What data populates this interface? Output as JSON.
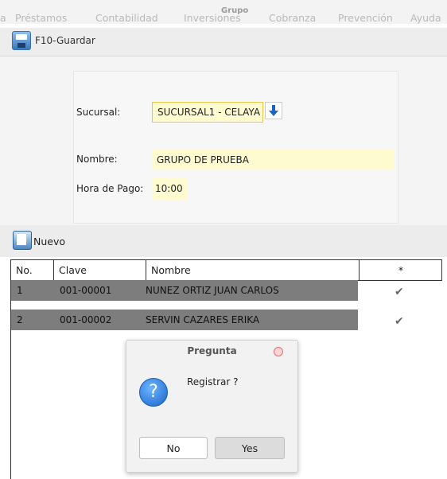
{
  "menu": {
    "title": "Grupo",
    "items": [
      "a",
      "Préstamos",
      "Contabilidad",
      "Inversiones",
      "Cobranza",
      "Prevención",
      "Ayuda"
    ]
  },
  "toolbar": {
    "save_label": "F10-Guardar"
  },
  "form": {
    "sucursal_label": "Sucursal:",
    "sucursal_value": "SUCURSAL1 - CELAYA",
    "nombre_label": "Nombre:",
    "nombre_value": "GRUPO DE PRUEBA",
    "hora_label": "Hora de Pago:",
    "hora_value": "10:00"
  },
  "nuevo": {
    "label": "Nuevo"
  },
  "table": {
    "headers": [
      "No.",
      "Clave",
      "Nombre",
      "*"
    ],
    "rows": [
      {
        "no": "1",
        "clave": "001-00001",
        "nombre": "NUNEZ ORTIZ JUAN CARLOS"
      },
      {
        "no": "2",
        "clave": "001-00002",
        "nombre": "SERVIN CAZARES ERIKA"
      }
    ]
  },
  "dialog": {
    "title": "Pregunta",
    "message": "Registrar ?",
    "no_label": "No",
    "yes_label": "Yes"
  },
  "icons": {
    "save": "save-icon",
    "dropdown": "arrow-down-icon",
    "new": "new-document-icon",
    "check": "check-icon",
    "question": "question-icon",
    "close": "close-icon"
  },
  "colors": {
    "field_background": "#fffbd0",
    "selected_row": "#7d7d7d",
    "accent_blue": "#1a63c8"
  }
}
